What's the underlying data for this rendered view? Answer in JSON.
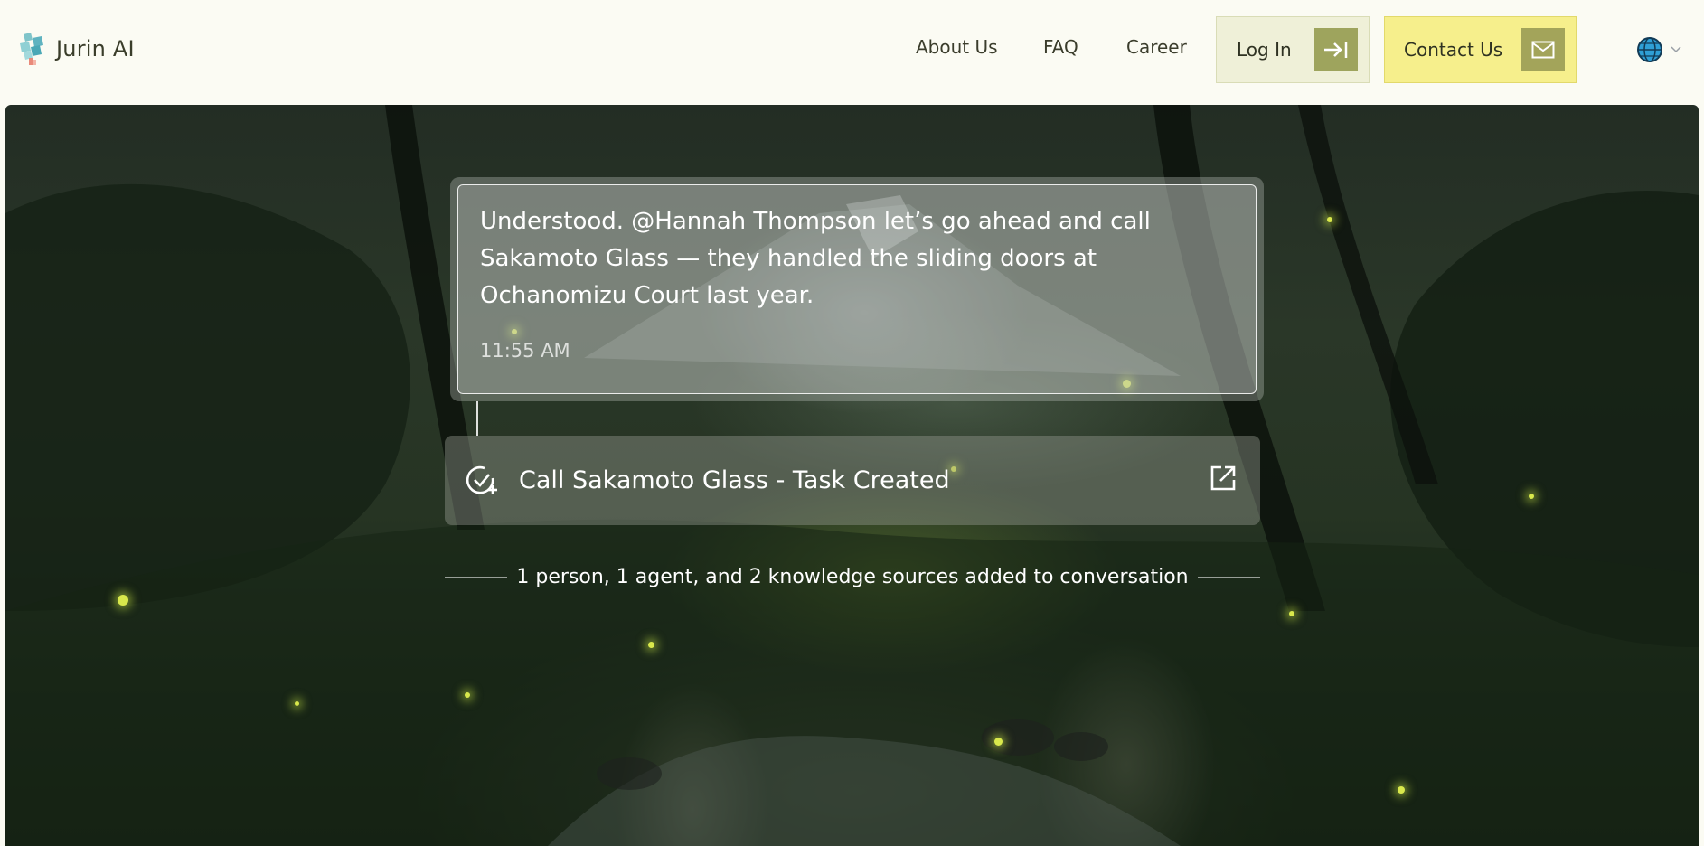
{
  "brand": {
    "name": "Jurin AI",
    "logo_icon": "jurin-logo-icon"
  },
  "nav": {
    "links": [
      {
        "label": "About Us"
      },
      {
        "label": "FAQ"
      },
      {
        "label": "Career"
      }
    ],
    "login_label": "Log In",
    "login_icon": "arrow-to-right-icon",
    "contact_label": "Contact Us",
    "contact_icon": "mail-icon",
    "language_icon": "globe-icon"
  },
  "colors": {
    "login_bg": "#eff0d8",
    "contact_bg": "#f6ef8c",
    "icon_olive": "#9ea45d"
  },
  "conversation": {
    "message": {
      "text": "Understood. @Hannah Thompson let’s go ahead and call Sakamoto Glass — they handled the sliding doors at Ochanomizu Court last year.",
      "time": "11:55 AM"
    },
    "task": {
      "icon": "check-circle-plus-icon",
      "label": "Call Sakamoto Glass - Task Created",
      "open_icon": "external-link-icon"
    },
    "system_note": "1 person, 1 agent, and 2 knowledge sources added to conversation"
  }
}
